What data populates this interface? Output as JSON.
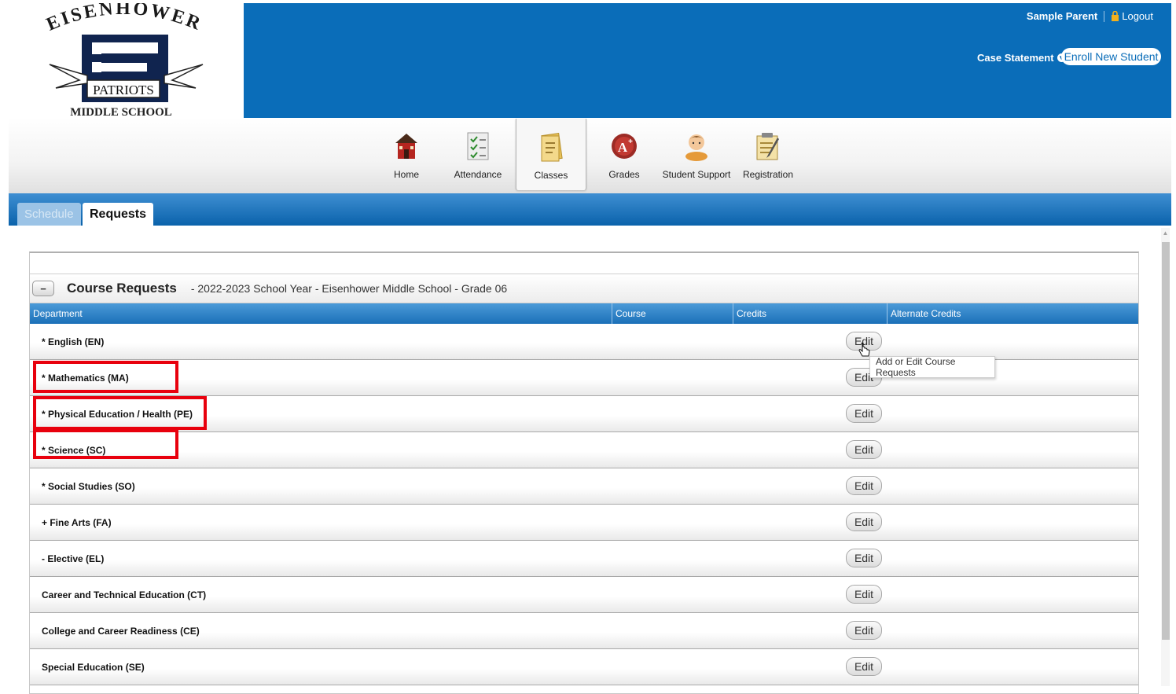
{
  "school": {
    "logo_top_text": "EISENHOWER",
    "logo_letter": "E",
    "logo_banner": "PATRIOTS",
    "logo_bottom_text": "MIDDLE SCHOOL"
  },
  "header": {
    "user_name": "Sample Parent",
    "logout_label": "Logout",
    "case_statement_label": "Case Statement",
    "enroll_label": "Enroll New Student",
    "bg_color": "#0a6db9"
  },
  "nav": {
    "items": [
      {
        "label": "Home",
        "icon": "schoolhouse-icon"
      },
      {
        "label": "Attendance",
        "icon": "attendance-icon"
      },
      {
        "label": "Classes",
        "icon": "classes-icon",
        "active": true
      },
      {
        "label": "Grades",
        "icon": "grades-icon"
      },
      {
        "label": "Student Support",
        "icon": "student-support-icon"
      },
      {
        "label": "Registration",
        "icon": "registration-icon"
      }
    ]
  },
  "subtabs": {
    "schedule_label": "Schedule",
    "requests_label": "Requests"
  },
  "panel": {
    "collapse_symbol": "−",
    "title": "Course Requests",
    "subtitle": "- 2022-2023 School Year - Eisenhower Middle School - Grade 06",
    "columns": {
      "department": "Department",
      "course": "Course",
      "credits": "Credits",
      "alternate_credits": "Alternate Credits"
    },
    "edit_label": "Edit",
    "rows": [
      {
        "label": "* English (EN)"
      },
      {
        "label": "* Mathematics (MA)"
      },
      {
        "label": "* Physical Education / Health (PE)"
      },
      {
        "label": "* Science (SC)"
      },
      {
        "label": "* Social Studies (SO)"
      },
      {
        "label": "+ Fine Arts (FA)"
      },
      {
        "label": "- Elective (EL)"
      },
      {
        "label": "Career and Technical Education (CT)"
      },
      {
        "label": "College and Career Readiness (CE)"
      },
      {
        "label": "Special Education (SE)"
      }
    ]
  },
  "tooltip": {
    "text": "Add or Edit Course Requests"
  },
  "colors": {
    "highlight": "#e8000d",
    "table_header": "#1b70b8"
  }
}
